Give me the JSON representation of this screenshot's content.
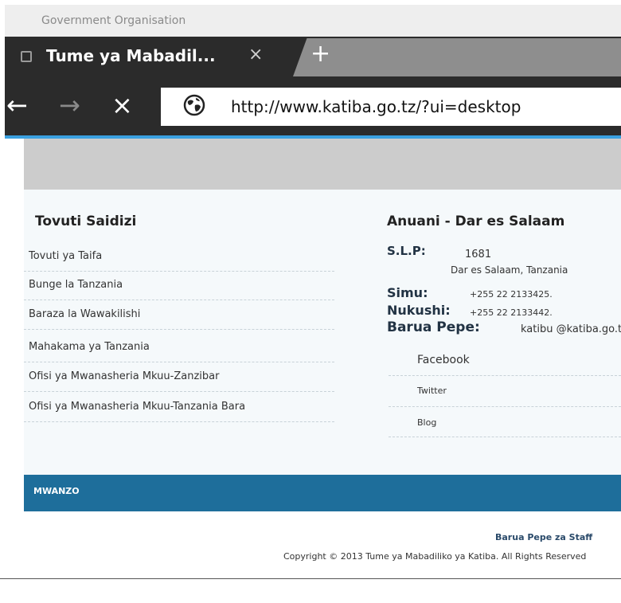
{
  "window": {
    "title": "Government Organisation"
  },
  "tab": {
    "title": "Tume ya Mabadil...",
    "close": "×",
    "new_tab": "+"
  },
  "nav": {
    "back": "←",
    "forward": "→",
    "stop": "×",
    "url": "http://www.katiba.go.tz/?ui=desktop"
  },
  "left": {
    "heading": "Tovuti Saidizi",
    "links": [
      "Tovuti ya Taifa",
      "Bunge la Tanzania",
      "Baraza la Wawakilishi",
      "Mahakama ya Tanzania",
      "Ofisi ya Mwanasheria Mkuu-Zanzibar",
      "Ofisi ya Mwanasheria Mkuu-Tanzania Bara"
    ]
  },
  "right": {
    "heading": "Anuani - Dar es Salaam",
    "slp_label": "S.L.P:",
    "slp_value": "1681",
    "city": "Dar es Salaam, Tanzania",
    "simu_label": "Simu:",
    "simu_value": "+255 22 2133425.",
    "nukushi_label": "Nukushi:",
    "nukushi_value": "+255 22 2133442.",
    "barua_label": "Barua Pepe:",
    "barua_value": "katibu @katiba.go.tz",
    "social": [
      "Facebook",
      "Twitter",
      "Blog"
    ]
  },
  "footer": {
    "nav": "MWANZO",
    "staff_link": "Barua Pepe za Staff",
    "copyright": "Copyright © 2013 Tume ya Mabadiliko ya Katiba. All Rights Reserved"
  },
  "colors": {
    "browser_chrome": "#2b2b2b",
    "progress": "#3aa0e0",
    "footer_bar": "#1e6e9b"
  }
}
